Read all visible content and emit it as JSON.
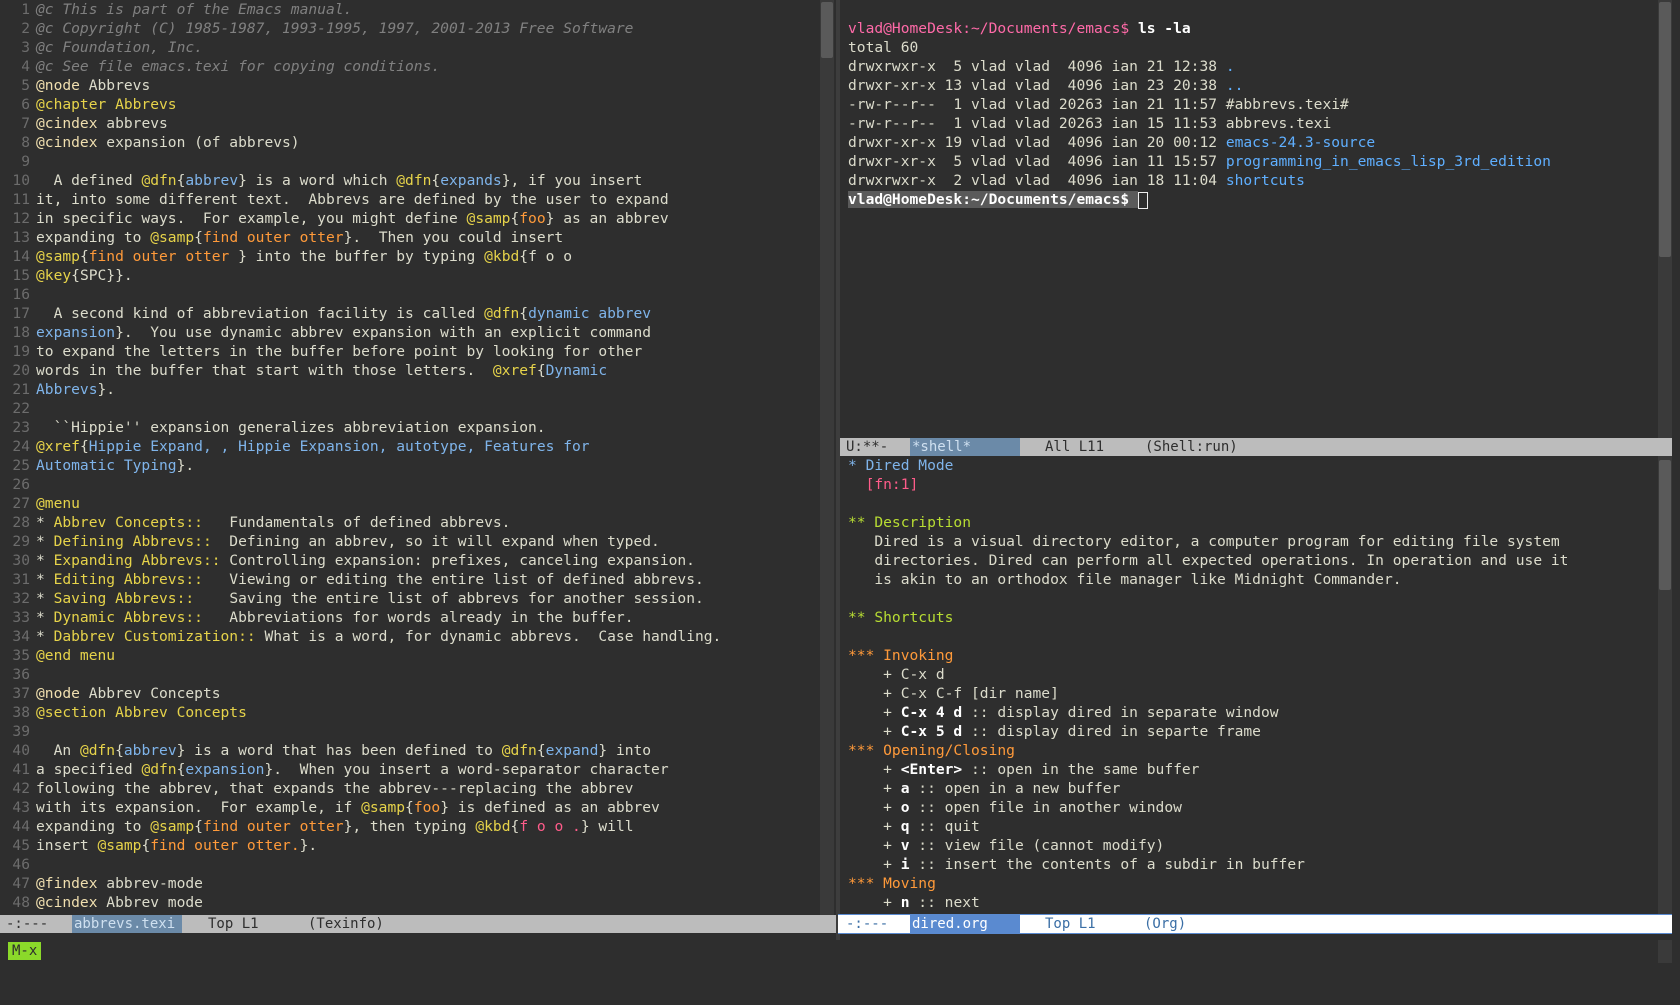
{
  "left": {
    "lines": [
      {
        "n": "1",
        "segs": [
          {
            "t": "@c This is part of the Emacs manual.",
            "c": "cm"
          }
        ]
      },
      {
        "n": "2",
        "segs": [
          {
            "t": "@c Copyright (C) 1985-1987, 1993-1995, 1997, 2001-2013 Free Software",
            "c": "cm"
          }
        ]
      },
      {
        "n": "3",
        "segs": [
          {
            "t": "@c Foundation, Inc.",
            "c": "cm"
          }
        ]
      },
      {
        "n": "4",
        "segs": [
          {
            "t": "@c See file emacs.texi for copying conditions.",
            "c": "cm"
          }
        ]
      },
      {
        "n": "5",
        "segs": [
          {
            "t": "@node",
            "c": "kw"
          },
          {
            "t": " Abbrevs"
          }
        ]
      },
      {
        "n": "6",
        "segs": [
          {
            "t": "@chapter Abbrevs",
            "c": "kw2"
          }
        ]
      },
      {
        "n": "7",
        "segs": [
          {
            "t": "@cindex",
            "c": "kw"
          },
          {
            "t": " abbrevs"
          }
        ]
      },
      {
        "n": "8",
        "segs": [
          {
            "t": "@cindex",
            "c": "kw"
          },
          {
            "t": " expansion (of abbrevs)"
          }
        ]
      },
      {
        "n": "9",
        "segs": []
      },
      {
        "n": "10",
        "segs": [
          {
            "t": "  A defined "
          },
          {
            "t": "@dfn",
            "c": "kw2"
          },
          {
            "t": "{"
          },
          {
            "t": "abbrev",
            "c": "ar"
          },
          {
            "t": "} is a word which "
          },
          {
            "t": "@dfn",
            "c": "kw2"
          },
          {
            "t": "{"
          },
          {
            "t": "expands",
            "c": "ar"
          },
          {
            "t": "}, if you insert"
          }
        ]
      },
      {
        "n": "11",
        "segs": [
          {
            "t": "it, into some different text.  Abbrevs are defined by the user to expand"
          }
        ]
      },
      {
        "n": "12",
        "segs": [
          {
            "t": "in specific ways.  For example, you might define "
          },
          {
            "t": "@samp",
            "c": "kw2"
          },
          {
            "t": "{"
          },
          {
            "t": "foo",
            "c": "or"
          },
          {
            "t": "} as an abbrev"
          }
        ]
      },
      {
        "n": "13",
        "segs": [
          {
            "t": "expanding to "
          },
          {
            "t": "@samp",
            "c": "kw2"
          },
          {
            "t": "{"
          },
          {
            "t": "find outer otter",
            "c": "or"
          },
          {
            "t": "}.  Then you could insert"
          }
        ]
      },
      {
        "n": "14",
        "segs": [
          {
            "t": "@samp",
            "c": "kw2"
          },
          {
            "t": "{"
          },
          {
            "t": "find outer otter",
            "c": "or"
          },
          {
            "t": " } into the buffer by typing "
          },
          {
            "t": "@kbd",
            "c": "kw2"
          },
          {
            "t": "{f o o"
          }
        ]
      },
      {
        "n": "15",
        "segs": [
          {
            "t": "@key",
            "c": "kw2"
          },
          {
            "t": "{SPC}}."
          }
        ]
      },
      {
        "n": "16",
        "segs": []
      },
      {
        "n": "17",
        "segs": [
          {
            "t": "  A second kind of abbreviation facility is called "
          },
          {
            "t": "@dfn",
            "c": "kw2"
          },
          {
            "t": "{"
          },
          {
            "t": "dynamic abbrev",
            "c": "ar"
          }
        ]
      },
      {
        "n": "18",
        "segs": [
          {
            "t": "expansion",
            "c": "ar"
          },
          {
            "t": "}.  You use dynamic abbrev expansion with an explicit command"
          }
        ]
      },
      {
        "n": "19",
        "segs": [
          {
            "t": "to expand the letters in the buffer before point by looking for other"
          }
        ]
      },
      {
        "n": "20",
        "segs": [
          {
            "t": "words in the buffer that start with those letters.  "
          },
          {
            "t": "@xref",
            "c": "kw2"
          },
          {
            "t": "{"
          },
          {
            "t": "Dynamic",
            "c": "ar"
          }
        ]
      },
      {
        "n": "21",
        "segs": [
          {
            "t": "Abbrevs",
            "c": "ar"
          },
          {
            "t": "}."
          }
        ]
      },
      {
        "n": "22",
        "segs": []
      },
      {
        "n": "23",
        "segs": [
          {
            "t": "  ``Hippie'' expansion generalizes abbreviation expansion."
          }
        ]
      },
      {
        "n": "24",
        "segs": [
          {
            "t": "@xref",
            "c": "kw2"
          },
          {
            "t": "{"
          },
          {
            "t": "Hippie Expand, , Hippie Expansion, autotype, Features for",
            "c": "ar"
          }
        ]
      },
      {
        "n": "25",
        "segs": [
          {
            "t": "Automatic Typing",
            "c": "ar"
          },
          {
            "t": "}."
          }
        ]
      },
      {
        "n": "26",
        "segs": []
      },
      {
        "n": "27",
        "segs": [
          {
            "t": "@menu",
            "c": "kw2"
          }
        ]
      },
      {
        "n": "28",
        "segs": [
          {
            "t": "* "
          },
          {
            "t": "Abbrev Concepts::",
            "c": "kw2"
          },
          {
            "t": "   Fundamentals of defined abbrevs."
          }
        ]
      },
      {
        "n": "29",
        "segs": [
          {
            "t": "* "
          },
          {
            "t": "Defining Abbrevs::",
            "c": "kw2"
          },
          {
            "t": "  Defining an abbrev, so it will expand when typed."
          }
        ]
      },
      {
        "n": "30",
        "segs": [
          {
            "t": "* "
          },
          {
            "t": "Expanding Abbrevs::",
            "c": "kw2"
          },
          {
            "t": " Controlling expansion: prefixes, canceling expansion."
          }
        ]
      },
      {
        "n": "31",
        "segs": [
          {
            "t": "* "
          },
          {
            "t": "Editing Abbrevs::",
            "c": "kw2"
          },
          {
            "t": "   Viewing or editing the entire list of defined abbrevs."
          }
        ]
      },
      {
        "n": "32",
        "segs": [
          {
            "t": "* "
          },
          {
            "t": "Saving Abbrevs::",
            "c": "kw2"
          },
          {
            "t": "    Saving the entire list of abbrevs for another session."
          }
        ]
      },
      {
        "n": "33",
        "segs": [
          {
            "t": "* "
          },
          {
            "t": "Dynamic Abbrevs::",
            "c": "kw2"
          },
          {
            "t": "   Abbreviations for words already in the buffer."
          }
        ]
      },
      {
        "n": "34",
        "segs": [
          {
            "t": "* "
          },
          {
            "t": "Dabbrev Customization::",
            "c": "kw2"
          },
          {
            "t": " What is a word, for dynamic abbrevs.  Case handling."
          }
        ]
      },
      {
        "n": "35",
        "segs": [
          {
            "t": "@end menu",
            "c": "kw2"
          }
        ]
      },
      {
        "n": "36",
        "segs": []
      },
      {
        "n": "37",
        "segs": [
          {
            "t": "@node",
            "c": "kw"
          },
          {
            "t": " Abbrev Concepts"
          }
        ]
      },
      {
        "n": "38",
        "segs": [
          {
            "t": "@section Abbrev Concepts",
            "c": "kw2"
          }
        ]
      },
      {
        "n": "39",
        "segs": []
      },
      {
        "n": "40",
        "segs": [
          {
            "t": "  An "
          },
          {
            "t": "@dfn",
            "c": "kw2"
          },
          {
            "t": "{"
          },
          {
            "t": "abbrev",
            "c": "ar"
          },
          {
            "t": "} is a word that has been defined to "
          },
          {
            "t": "@dfn",
            "c": "kw2"
          },
          {
            "t": "{"
          },
          {
            "t": "expand",
            "c": "ar"
          },
          {
            "t": "} into"
          }
        ]
      },
      {
        "n": "41",
        "segs": [
          {
            "t": "a specified "
          },
          {
            "t": "@dfn",
            "c": "kw2"
          },
          {
            "t": "{"
          },
          {
            "t": "expansion",
            "c": "ar"
          },
          {
            "t": "}.  When you insert a word-separator character"
          }
        ]
      },
      {
        "n": "42",
        "segs": [
          {
            "t": "following the abbrev, that expands the abbrev---replacing the abbrev"
          }
        ]
      },
      {
        "n": "43",
        "segs": [
          {
            "t": "with its expansion.  For example, if "
          },
          {
            "t": "@samp",
            "c": "kw2"
          },
          {
            "t": "{"
          },
          {
            "t": "foo",
            "c": "or"
          },
          {
            "t": "} is defined as an abbrev"
          }
        ]
      },
      {
        "n": "44",
        "segs": [
          {
            "t": "expanding to "
          },
          {
            "t": "@samp",
            "c": "kw2"
          },
          {
            "t": "{"
          },
          {
            "t": "find outer otter",
            "c": "or"
          },
          {
            "t": "}, then typing "
          },
          {
            "t": "@kbd",
            "c": "kw2"
          },
          {
            "t": "{"
          },
          {
            "t": "f o o .",
            "c": "fn"
          },
          {
            "t": "} will"
          }
        ]
      },
      {
        "n": "45",
        "segs": [
          {
            "t": "insert "
          },
          {
            "t": "@samp",
            "c": "kw2"
          },
          {
            "t": "{"
          },
          {
            "t": "find outer otter.",
            "c": "or"
          },
          {
            "t": "}."
          }
        ]
      },
      {
        "n": "46",
        "segs": []
      },
      {
        "n": "47",
        "segs": [
          {
            "t": "@findex",
            "c": "kw"
          },
          {
            "t": " abbrev-mode"
          }
        ]
      },
      {
        "n": "48",
        "segs": [
          {
            "t": "@cindex",
            "c": "kw"
          },
          {
            "t": " Abbrev mode"
          }
        ]
      }
    ],
    "modeline": {
      "status": "-:---",
      "buffer": "abbrevs.texi",
      "pos": "Top L1",
      "mode": "(Texinfo)"
    }
  },
  "shell": {
    "lines": [
      {
        "segs": [
          {
            "t": "vlad@HomeDesk:~/Documents/emacs$ ",
            "c": "pr"
          },
          {
            "t": "ls -la",
            "c": "bold"
          }
        ]
      },
      {
        "segs": [
          {
            "t": "total 60"
          }
        ]
      },
      {
        "segs": [
          {
            "t": "drwxrwxr-x  5 vlad vlad  4096 ian 21 12:38 "
          },
          {
            "t": ".",
            "c": "dir"
          }
        ]
      },
      {
        "segs": [
          {
            "t": "drwxr-xr-x 13 vlad vlad  4096 ian 23 20:38 "
          },
          {
            "t": "..",
            "c": "dir"
          }
        ]
      },
      {
        "segs": [
          {
            "t": "-rw-r--r--  1 vlad vlad 20263 ian 21 11:57 #abbrevs.texi#"
          }
        ]
      },
      {
        "segs": [
          {
            "t": "-rw-r--r--  1 vlad vlad 20263 ian 15 11:53 abbrevs.texi"
          }
        ]
      },
      {
        "segs": [
          {
            "t": "drwxr-xr-x 19 vlad vlad  4096 ian 20 00:12 "
          },
          {
            "t": "emacs-24.3-source",
            "c": "dir"
          }
        ]
      },
      {
        "segs": [
          {
            "t": "drwxr-xr-x  5 vlad vlad  4096 ian 11 15:57 "
          },
          {
            "t": "programming_in_emacs_lisp_3rd_edition",
            "c": "dir"
          }
        ]
      },
      {
        "segs": [
          {
            "t": "drwxrwxr-x  2 vlad vlad  4096 ian 18 11:04 "
          },
          {
            "t": "shortcuts",
            "c": "dir"
          }
        ]
      },
      {
        "segs": [
          {
            "t": "vlad@HomeDesk:~/Documents/emacs$ ",
            "c": "bold"
          }
        ],
        "cursor": true
      }
    ],
    "modeline": {
      "status": "U:**-",
      "buffer": "*shell*",
      "pos": "All L11",
      "mode": "(Shell:run)"
    }
  },
  "org": {
    "lines": [
      {
        "segs": [
          {
            "t": "* ",
            "c": "ar"
          },
          {
            "t": "Dired Mode",
            "c": "ar"
          }
        ]
      },
      {
        "segs": [
          {
            "t": "  [fn:1]",
            "c": "fn"
          }
        ]
      },
      {
        "segs": []
      },
      {
        "segs": [
          {
            "t": "** Description",
            "c": "h2"
          }
        ]
      },
      {
        "segs": [
          {
            "t": "   Dired is a visual directory editor, a computer program for editing file system"
          }
        ]
      },
      {
        "segs": [
          {
            "t": "   directories. Dired can perform all expected operations. In operation and use it"
          }
        ]
      },
      {
        "segs": [
          {
            "t": "   is akin to an orthodox file manager like Midnight Commander."
          }
        ]
      },
      {
        "segs": []
      },
      {
        "segs": [
          {
            "t": "** Shortcuts",
            "c": "h2"
          }
        ]
      },
      {
        "segs": []
      },
      {
        "segs": [
          {
            "t": "*** Invoking",
            "c": "h3"
          }
        ]
      },
      {
        "segs": [
          {
            "t": "    + C-x d"
          }
        ]
      },
      {
        "segs": [
          {
            "t": "    + C-x C-f [dir name]"
          }
        ]
      },
      {
        "segs": [
          {
            "t": "    + "
          },
          {
            "t": "C-x 4 d",
            "c": "bold"
          },
          {
            "t": " :: display dired in separate window"
          }
        ]
      },
      {
        "segs": [
          {
            "t": "    + "
          },
          {
            "t": "C-x 5 d",
            "c": "bold"
          },
          {
            "t": " :: display dired in separte frame"
          }
        ]
      },
      {
        "segs": [
          {
            "t": "*** Opening/Closing",
            "c": "h3"
          }
        ]
      },
      {
        "segs": [
          {
            "t": "    + "
          },
          {
            "t": "<Enter>",
            "c": "bold"
          },
          {
            "t": " :: open in the same buffer"
          }
        ]
      },
      {
        "segs": [
          {
            "t": "    + "
          },
          {
            "t": "a",
            "c": "bold"
          },
          {
            "t": " :: open in a new buffer"
          }
        ]
      },
      {
        "segs": [
          {
            "t": "    + "
          },
          {
            "t": "o",
            "c": "bold"
          },
          {
            "t": " :: open file in another window"
          }
        ]
      },
      {
        "segs": [
          {
            "t": "    + "
          },
          {
            "t": "q",
            "c": "bold"
          },
          {
            "t": " :: quit"
          }
        ]
      },
      {
        "segs": [
          {
            "t": "    + "
          },
          {
            "t": "v",
            "c": "bold"
          },
          {
            "t": " :: view file (cannot modify)"
          }
        ]
      },
      {
        "segs": [
          {
            "t": "    + "
          },
          {
            "t": "i",
            "c": "bold"
          },
          {
            "t": " :: insert the contents of a subdir in buffer"
          }
        ]
      },
      {
        "segs": [
          {
            "t": "*** Moving",
            "c": "h3"
          }
        ]
      },
      {
        "segs": [
          {
            "t": "    + "
          },
          {
            "t": "n",
            "c": "bold"
          },
          {
            "t": " :: next"
          }
        ]
      }
    ],
    "modeline": {
      "status": "-:---",
      "buffer": "dired.org",
      "pos": "Top L1",
      "mode": "(Org)"
    }
  },
  "minibuffer": {
    "prompt": "M-x"
  },
  "colors": {
    "background": "#2e2e2e",
    "keyword": "#e6d34a",
    "link": "#7fb4ea",
    "string": "#ff9a3a",
    "heading2": "#b8dd33"
  }
}
